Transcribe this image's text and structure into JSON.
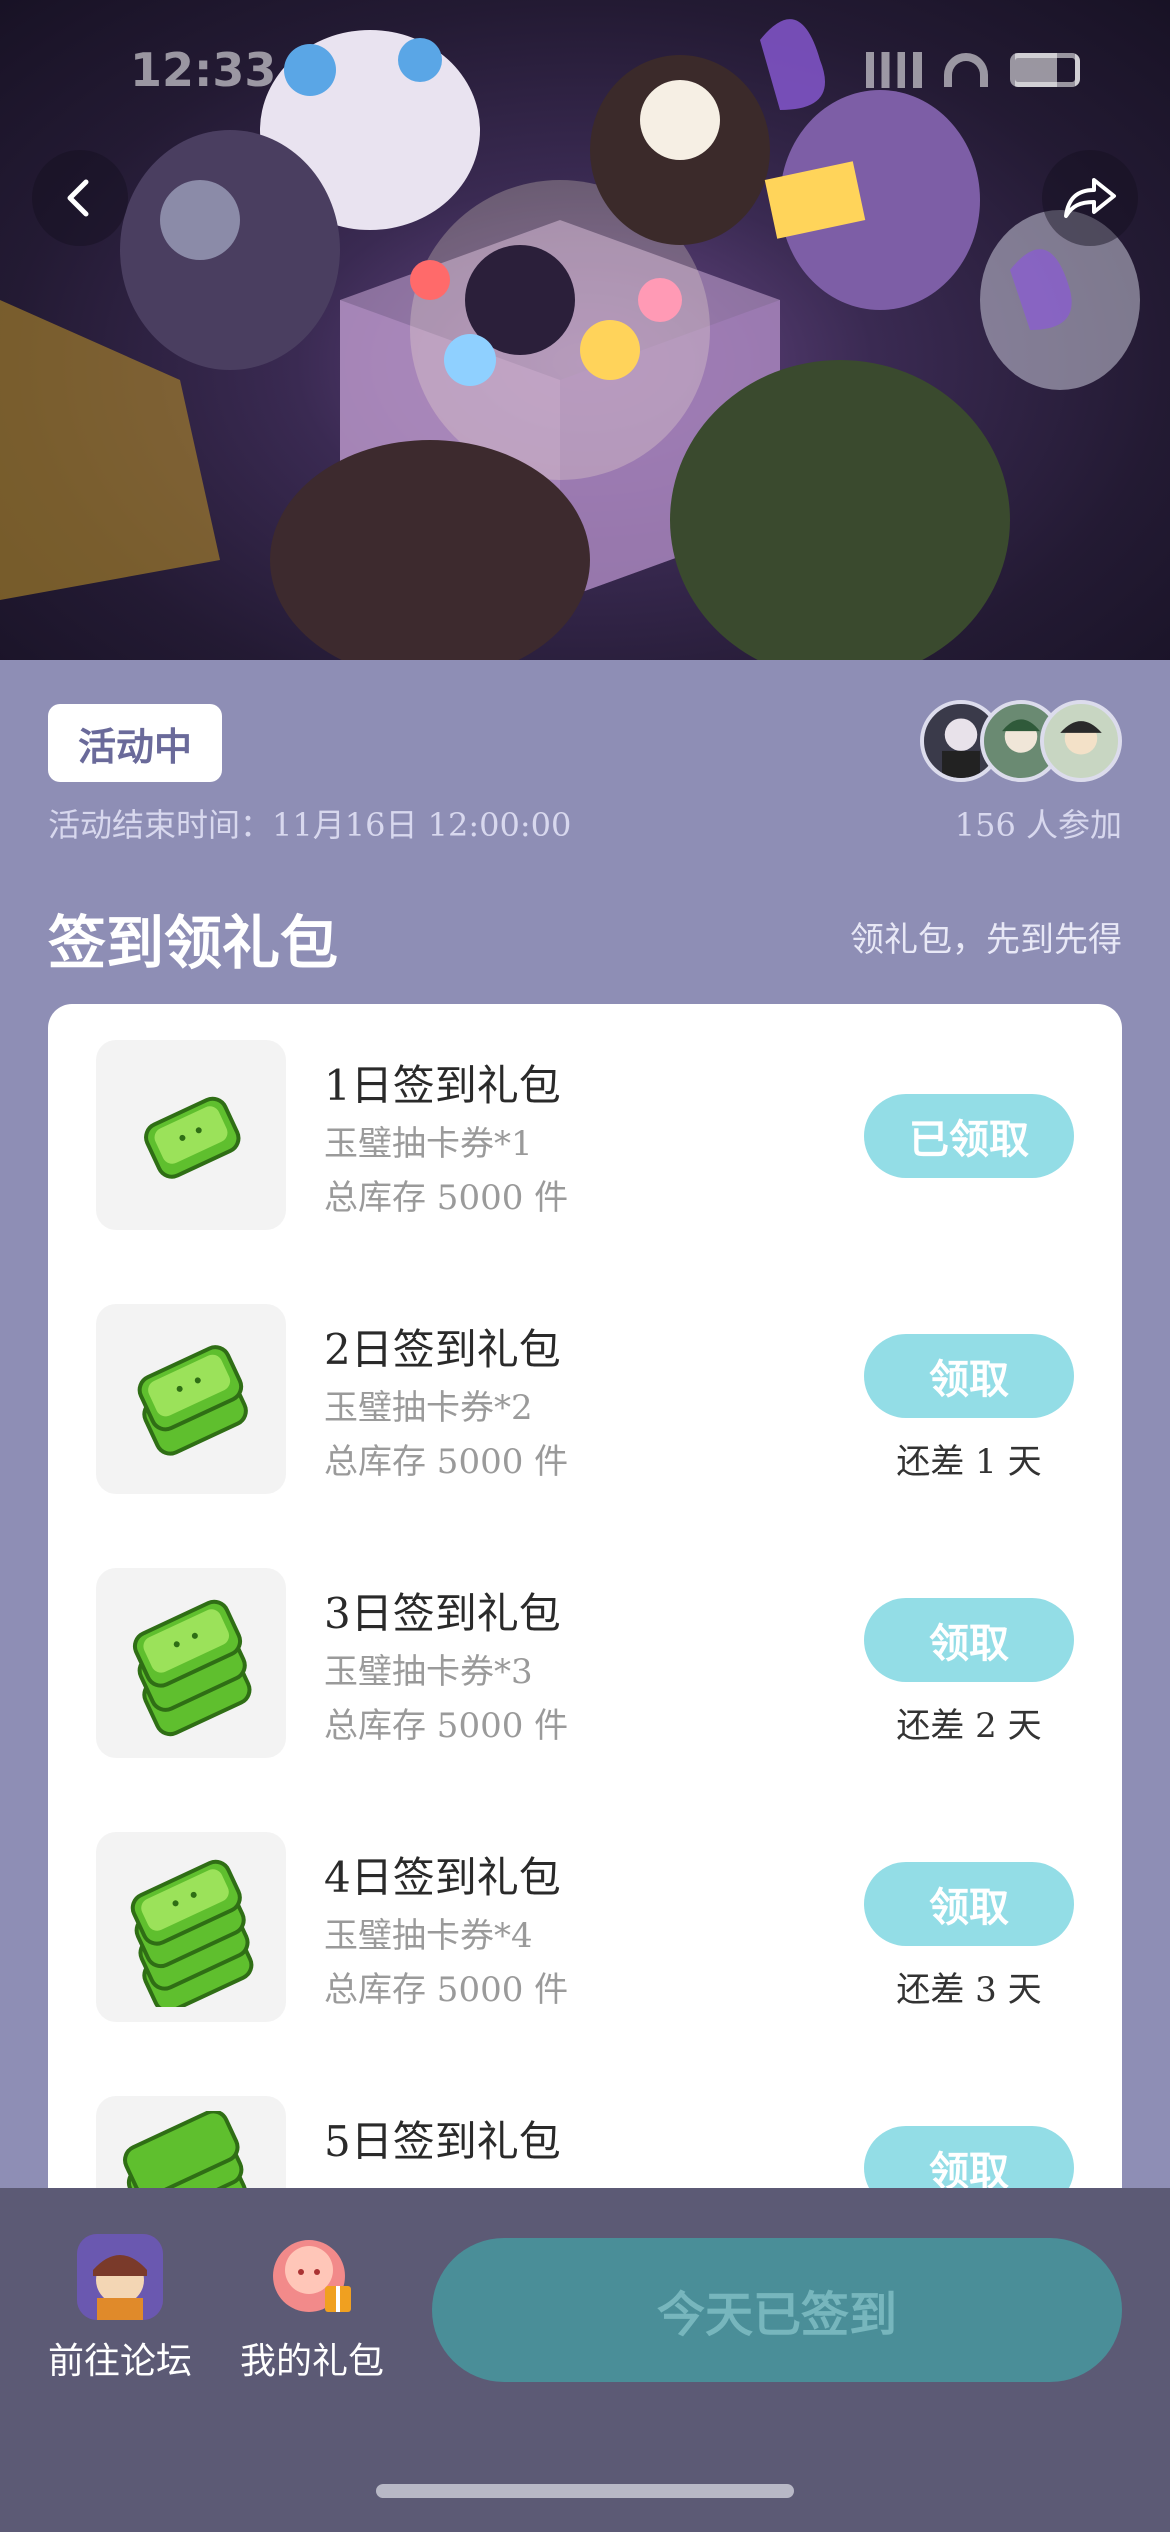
{
  "status_bar": {
    "time": "12:33"
  },
  "hero": {
    "share_icon": "share-icon",
    "back_icon": "chevron-left-icon"
  },
  "event": {
    "status_tag": "活动中",
    "end_time": "活动结束时间：11月16日 12:00:00",
    "participants": "156 人参加"
  },
  "section": {
    "title": "签到领礼包",
    "subtitle": "领礼包，先到先得"
  },
  "rewards": [
    {
      "title": "1日签到礼包",
      "desc": "玉璧抽卡券*1",
      "stock": "总库存 5000 件",
      "button": "已领取",
      "days_left": ""
    },
    {
      "title": "2日签到礼包",
      "desc": "玉璧抽卡券*2",
      "stock": "总库存 5000 件",
      "button": "领取",
      "days_left": "还差 1 天"
    },
    {
      "title": "3日签到礼包",
      "desc": "玉璧抽卡券*3",
      "stock": "总库存 5000 件",
      "button": "领取",
      "days_left": "还差 2 天"
    },
    {
      "title": "4日签到礼包",
      "desc": "玉璧抽卡券*4",
      "stock": "总库存 5000 件",
      "button": "领取",
      "days_left": "还差 3 天"
    },
    {
      "title": "5日签到礼包",
      "desc": "",
      "stock": "",
      "button": "领取",
      "days_left": ""
    }
  ],
  "bottom": {
    "forum_label": "前往论坛",
    "gift_label": "我的礼包",
    "signed_button": "今天已签到"
  },
  "colors": {
    "page_bg": "#8e8eb5",
    "button_teal": "#93dde6",
    "bottom_bar": "#5c5a75",
    "signed_button": "#4a8e98"
  }
}
